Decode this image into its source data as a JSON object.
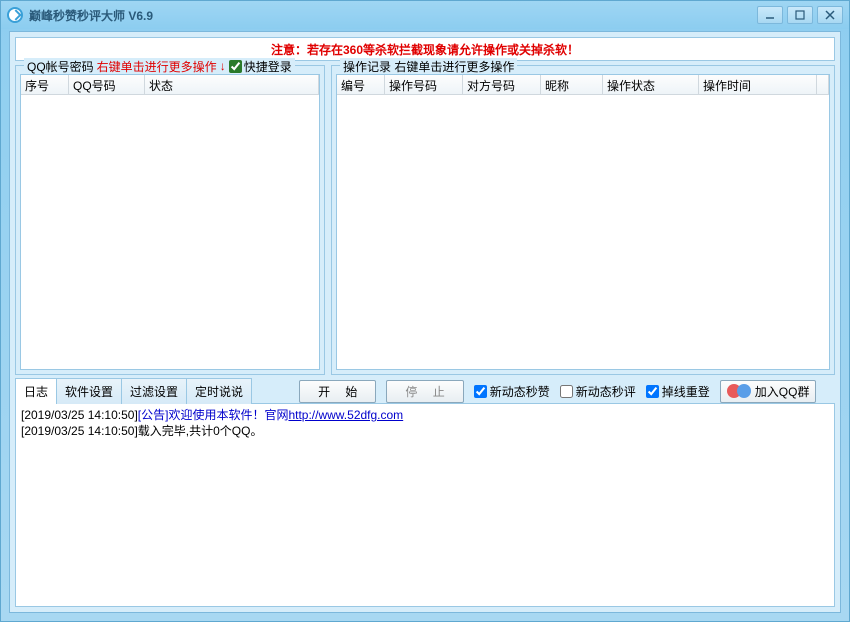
{
  "window": {
    "title": "巅峰秒赞秒评大师 V6.9"
  },
  "warning": "注意：若存在360等杀软拦截现象请允许操作或关掉杀软！",
  "leftPanel": {
    "legendPrefix": "QQ帐号密码",
    "legendRed": "右键单击进行更多操作",
    "quickLogin": "快捷登录",
    "columns": [
      "序号",
      "QQ号码",
      "状态"
    ]
  },
  "rightPanel": {
    "legend": "操作记录   右键单击进行更多操作",
    "columns": [
      "编号",
      "操作号码",
      "对方号码",
      "昵称",
      "操作状态",
      "操作时间"
    ]
  },
  "tabs": [
    "日志",
    "软件设置",
    "过滤设置",
    "定时说说"
  ],
  "buttons": {
    "start": "开 始",
    "stop": "停 止",
    "joinQQ": "加入QQ群"
  },
  "checkboxes": {
    "newLike": "新动态秒赞",
    "newComment": "新动态秒评",
    "reconnect": "掉线重登"
  },
  "log": [
    {
      "ts": "[2019/03/25 14:10:50]",
      "bluePart": "[公告]欢迎使用本软件！官网",
      "link": "http://www.52dfg.com"
    },
    {
      "ts": "[2019/03/25 14:10:50]",
      "blackPart": "载入完毕,共计0个QQ。"
    }
  ]
}
